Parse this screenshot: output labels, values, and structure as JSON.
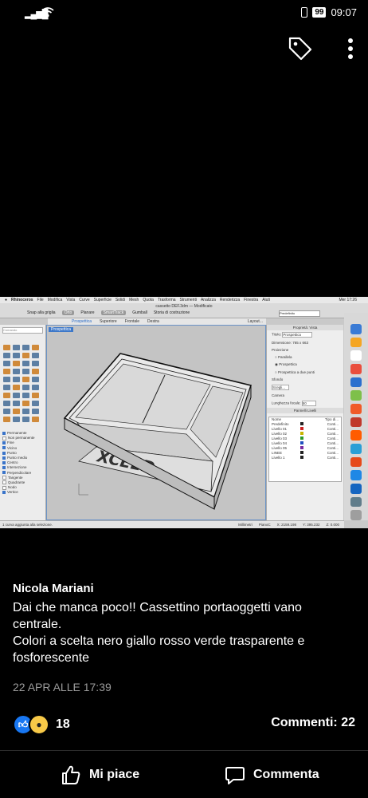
{
  "status_bar": {
    "signal": "▂▄▆█",
    "battery": "99",
    "time": "09:07"
  },
  "top_actions": {
    "tag_icon": "tag-icon",
    "more_icon": "more-vertical-icon"
  },
  "screenshot": {
    "menubar": [
      "Rhinoceros",
      "File",
      "Modifica",
      "Vista",
      "Curve",
      "Superficie",
      "Solidi",
      "Mesh",
      "Quota",
      "Trasforma",
      "Strumenti",
      "Analizza",
      "Renderizza",
      "Finestra",
      "Aiuti"
    ],
    "clock": "Mer 17:26",
    "file_title": "cassetto DEF.3dm — Modificato",
    "toolbar": [
      "Snap alla griglia",
      "Orto",
      "Planare",
      "SmartTrack",
      "Gumball",
      "Storia di costruzione"
    ],
    "layer_dropdown": "Predefinito",
    "view_tabs": [
      "Prospettica",
      "Superiore",
      "Frontale",
      "Destra"
    ],
    "layout_button": "Layout...",
    "viewport_label": "Prospettica",
    "search_placeholder": "Comando",
    "osnaps": [
      {
        "label": "Permanente",
        "on": true
      },
      {
        "label": "Non permanente",
        "on": false
      },
      {
        "label": "Fine",
        "on": true
      },
      {
        "label": "Vicino",
        "on": true
      },
      {
        "label": "Punto",
        "on": true
      },
      {
        "label": "Punto medio",
        "on": true
      },
      {
        "label": "Centro",
        "on": true
      },
      {
        "label": "Intersezione",
        "on": true
      },
      {
        "label": "Perpendicolare",
        "on": true
      },
      {
        "label": "Tangente",
        "on": false
      },
      {
        "label": "Quadrante",
        "on": false
      },
      {
        "label": "Nodo",
        "on": false
      },
      {
        "label": "Vertice",
        "on": true
      }
    ],
    "properties": {
      "header": "Proprietà: Vista",
      "title_label": "Titolo:",
      "title_value": "Prospettica",
      "dimension_label": "Dimensione:",
      "dimension_value": "765 x 663",
      "projection_label": "Proiezione",
      "projection_options": [
        "Parallela",
        "Prospettica",
        "Prospettica a due punti"
      ],
      "background_label": "Sfondo",
      "background_choose": "Scegli...",
      "camera_label": "Camera",
      "focal_label": "Lunghezza focale:",
      "focal_value": "50"
    },
    "layers_panel": {
      "title": "Pannelli Livelli",
      "col_name": "Nome",
      "col_linetype": "Tipo di...",
      "layers": [
        "Predefinito",
        "Livello 01",
        "Livello 02",
        "Livello 03",
        "Livello 04",
        "Livello 05",
        "LINEE",
        "Livello 1"
      ],
      "linetype": "Conti...",
      "colors": [
        "#222222",
        "#cc2222",
        "#c8b400",
        "#2a9a2a",
        "#2050c0",
        "#7a2aa0",
        "#222222",
        "#222222"
      ]
    },
    "status_message": "1 curva aggiunta alla selezione.",
    "units": "Millimetri",
    "cplane": "PianoC",
    "coords": [
      "X: 2159.198",
      "Y: 395.232",
      "Z: 0.000"
    ],
    "dock_colors": [
      "#3a7bd5",
      "#f5a623",
      "#ffffff",
      "#e94e3d",
      "#2b6fce",
      "#7ec04a",
      "#f05a28",
      "#c0392b",
      "#ff5c00",
      "#2a9fd6",
      "#e64a19",
      "#1e88e5",
      "#1565c0",
      "#607d8b",
      "#9e9e9e"
    ]
  },
  "post": {
    "author": "Nicola Mariani",
    "text_lines": [
      "Dai che manca poco!! Cassettino portaoggetti vano",
      "centrale.",
      "Colori a scelta nero giallo rosso verde trasparente e",
      "fosforescente"
    ],
    "date": "22 APR ALLE 17:39",
    "reactions_count": "18",
    "comments_label": "Commenti: 22"
  },
  "actions": {
    "like": "Mi piace",
    "comment": "Commenta"
  }
}
